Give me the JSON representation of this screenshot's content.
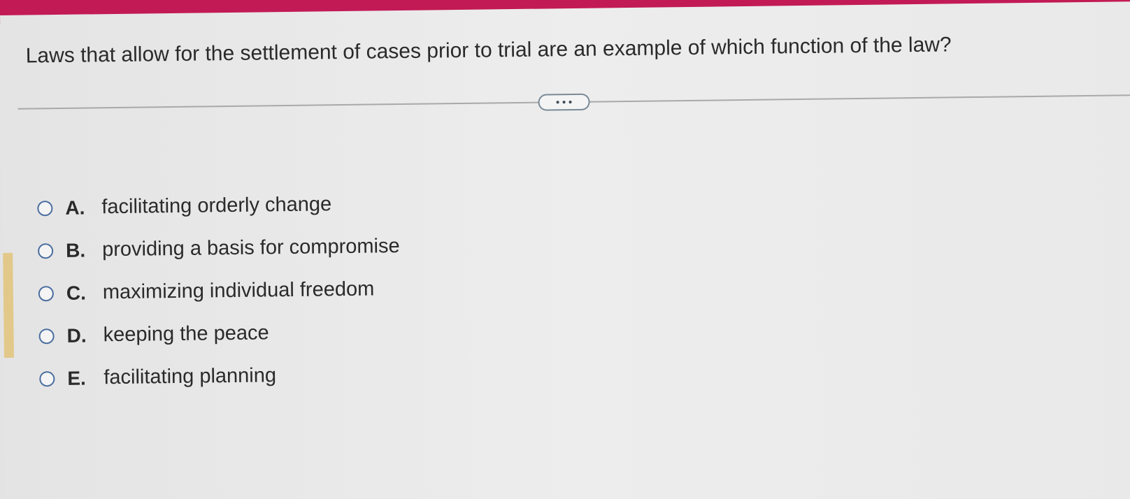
{
  "question": {
    "text": "Laws that allow for the settlement of cases prior to trial are an example of which function of the law?"
  },
  "more_button": {
    "icon": "ellipsis-icon"
  },
  "options": [
    {
      "letter": "A.",
      "text": "facilitating orderly change"
    },
    {
      "letter": "B.",
      "text": "providing a basis for compromise"
    },
    {
      "letter": "C.",
      "text": "maximizing individual freedom"
    },
    {
      "letter": "D.",
      "text": "keeping the peace"
    },
    {
      "letter": "E.",
      "text": "facilitating planning"
    }
  ],
  "colors": {
    "header": "#c21a55",
    "radio_border": "#4a6ea0",
    "text": "#2a2a2a"
  }
}
